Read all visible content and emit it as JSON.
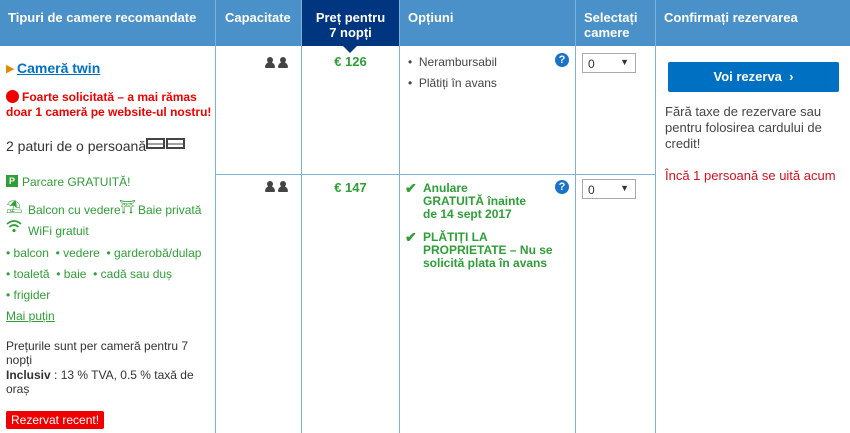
{
  "headers": {
    "room_types": "Tipuri de camere recomandate",
    "capacity": "Capacitate",
    "price_line1": "Preț pentru",
    "price_line2": "7 nopți",
    "options": "Opțiuni",
    "select_line1": "Selectați",
    "select_line2": "camere",
    "confirm": "Confirmați rezervarea"
  },
  "room": {
    "name": "Cameră twin",
    "alert_line1": "Foarte solicitată – a mai rămas",
    "alert_line2": "doar 1 cameră pe website-ul nostru!",
    "beds": "2 paturi de o persoană",
    "parking": "Parcare GRATUITĂ!",
    "balcony_view": "Balcon cu vedere",
    "private_bath": "Baie privată",
    "wifi": "WiFi gratuit",
    "amenities_line1": [
      "balcon",
      "vedere",
      "garderobă/dulap"
    ],
    "amenities_line2": [
      "toaletă",
      "baie",
      "cadă sau duș"
    ],
    "amenities_line3": [
      "frigider"
    ],
    "less_link": "Mai puțin",
    "price_note_line1": "Prețurile sunt per cameră pentru 7",
    "price_note_line2": "nopți",
    "inclusive_label": "Inclusiv",
    "inclusive_text_line1": " : 13 % TVA, 0.5 % taxă de",
    "inclusive_text_line2": "oraș",
    "recent_badge": "Rezervat recent!"
  },
  "offers": [
    {
      "price": "€ 126",
      "options": [
        "Nerambursabil",
        "Plătiți în avans"
      ],
      "selected": "0"
    },
    {
      "price": "€ 147",
      "option1_lines": [
        "Anulare",
        "GRATUITĂ înainte",
        "de 14 sept 2017"
      ],
      "option2_lines": [
        "PLĂTIȚI LA",
        "PROPRIETATE – Nu se",
        "solicită plata în avans"
      ],
      "selected": "0"
    }
  ],
  "confirm": {
    "button": "Voi rezerva",
    "note_line1": "Fără taxe de rezervare sau",
    "note_line2": "pentru folosirea cardului de",
    "note_line3": "credit!",
    "watching": "Încă 1 persoană se uită acum"
  },
  "colors": {
    "header": "#4a90c9",
    "price_header": "#003580",
    "button": "#0071c2",
    "green": "#2e9e36",
    "alert": "#e00"
  }
}
